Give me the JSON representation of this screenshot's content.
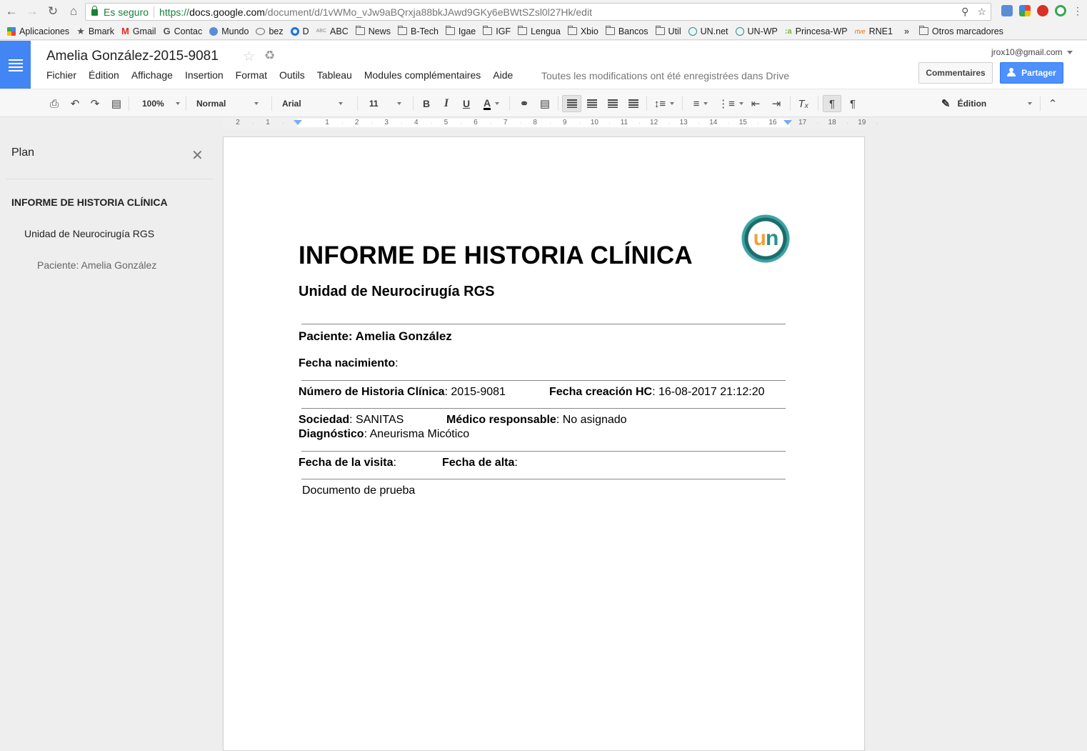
{
  "browser": {
    "secure_label": "Es seguro",
    "url_scheme": "https://",
    "url_host": "docs.google.com",
    "url_path": "/document/d/1vWMo_vJw9aBQrxja88bkJAwd9GKy6eBWtSZsl0l27Hk/edit"
  },
  "bookmarks": [
    {
      "label": "Aplicaciones",
      "icon": "apps-grid-icon"
    },
    {
      "label": "Bmark",
      "icon": "star-icon"
    },
    {
      "label": "Gmail",
      "icon": "gmail-icon"
    },
    {
      "label": "Contac",
      "icon": "google-icon"
    },
    {
      "label": "Mundo",
      "icon": "globe-icon"
    },
    {
      "label": "bez",
      "icon": "speech-bubble-icon"
    },
    {
      "label": "D",
      "icon": "circle-icon"
    },
    {
      "label": "ABC",
      "icon": "abc-icon"
    },
    {
      "label": "News",
      "icon": "folder-icon"
    },
    {
      "label": "B-Tech",
      "icon": "folder-icon"
    },
    {
      "label": "Igae",
      "icon": "folder-icon"
    },
    {
      "label": "IGF",
      "icon": "folder-icon"
    },
    {
      "label": "Lengua",
      "icon": "folder-icon"
    },
    {
      "label": "Xbio",
      "icon": "folder-icon"
    },
    {
      "label": "Bancos",
      "icon": "folder-icon"
    },
    {
      "label": "Util",
      "icon": "folder-icon"
    },
    {
      "label": "UN.net",
      "icon": "un-icon"
    },
    {
      "label": "UN-WP",
      "icon": "un-icon"
    },
    {
      "label": "Princesa-WP",
      "icon": "princesa-icon"
    },
    {
      "label": "RNE1",
      "icon": "rtve-icon"
    },
    {
      "label": "»",
      "icon": ""
    },
    {
      "label": "Otros marcadores",
      "icon": "folder-icon"
    }
  ],
  "docs": {
    "title": "Amelia González-2015-9081",
    "menu": [
      "Fichier",
      "Édition",
      "Affichage",
      "Insertion",
      "Format",
      "Outils",
      "Tableau",
      "Modules complémentaires",
      "Aide"
    ],
    "save_status": "Toutes les modifications ont été enregistrées dans Drive",
    "account": "jrox10@gmail.com",
    "comments_label": "Commentaires",
    "share_label": "Partager"
  },
  "toolbar": {
    "zoom": "100%",
    "style": "Normal",
    "font": "Arial",
    "size": "11",
    "bold": "B",
    "italic": "I",
    "underline": "U",
    "text_color": "A",
    "mode": "Édition"
  },
  "ruler": {
    "labels": [
      "2",
      "1",
      "1",
      "2",
      "3",
      "4",
      "5",
      "6",
      "7",
      "8",
      "9",
      "10",
      "11",
      "12",
      "13",
      "14",
      "15",
      "16",
      "17",
      "18",
      "19"
    ]
  },
  "outline": {
    "title": "Plan",
    "items": [
      {
        "label": "INFORME DE HISTORIA CLÍNICA",
        "level": 1
      },
      {
        "label": "Unidad de Neurocirugía RGS",
        "level": 2
      },
      {
        "label": "Paciente: Amelia González",
        "level": 3
      }
    ]
  },
  "document": {
    "title": "INFORME DE HISTORIA CLÍNICA",
    "subtitle": "Unidad de Neurocirugía RGS",
    "logo_text_u": "u",
    "logo_text_n": "n",
    "patient": "Paciente: Amelia González",
    "birth_label": "Fecha nacimiento",
    "birth_value": "",
    "hc_number_label": "Número de Historia Clínica",
    "hc_number_value": "2015-9081",
    "hc_created_label": "Fecha creación HC",
    "hc_created_value": "16-08-2017 21:12:20",
    "society_label": "Sociedad",
    "society_value": "SANITAS",
    "doctor_label": "Médico responsable",
    "doctor_value": "No asignado",
    "diagnosis_label": "Diagnóstico",
    "diagnosis_value": "Aneurisma Micótico",
    "visit_label": "Fecha de la visita",
    "visit_value": "",
    "discharge_label": "Fecha de alta",
    "discharge_value": "",
    "body_text": "Documento de prueba"
  },
  "colors": {
    "docs_blue": "#4285f4",
    "share_blue": "#4d90fe",
    "secure_green": "#188038",
    "logo_orange": "#f0a23a",
    "logo_teal": "#2a8f8f"
  }
}
